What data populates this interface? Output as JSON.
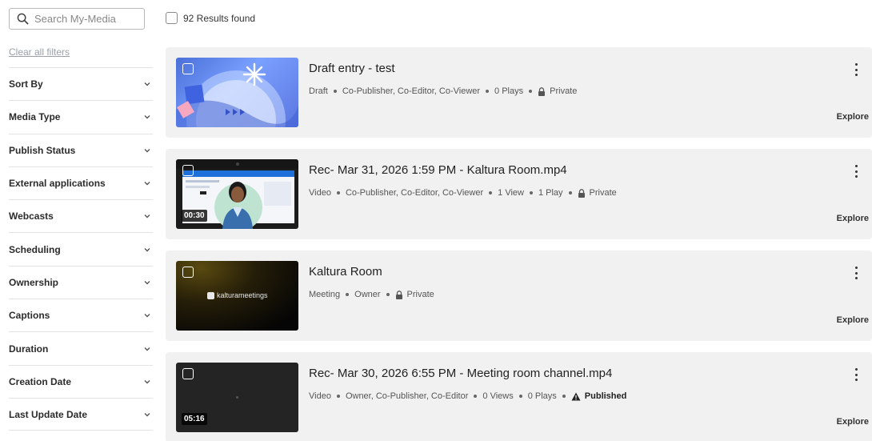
{
  "search": {
    "placeholder": "Search My-Media"
  },
  "sidebar": {
    "clear_filters": "Clear all filters",
    "filters": [
      "Sort By",
      "Media Type",
      "Publish Status",
      "External applications",
      "Webcasts",
      "Scheduling",
      "Ownership",
      "Captions",
      "Duration",
      "Creation Date",
      "Last Update Date"
    ]
  },
  "results": {
    "label": "92 Results found"
  },
  "entries": [
    {
      "title": "Draft entry - test",
      "meta": [
        "Draft",
        "Co-Publisher, Co-Editor, Co-Viewer",
        "0 Plays"
      ],
      "status": "Private",
      "status_icon": "lock-icon",
      "explore": "Explore"
    },
    {
      "title": "Rec- Mar 31, 2026 1:59 PM - Kaltura Room.mp4",
      "meta": [
        "Video",
        "Co-Publisher, Co-Editor, Co-Viewer",
        "1 View",
        "1 Play"
      ],
      "status": "Private",
      "status_icon": "lock-icon",
      "duration": "00:30",
      "explore": "Explore"
    },
    {
      "title": "Kaltura Room",
      "meta": [
        "Meeting",
        "Owner"
      ],
      "status": "Private",
      "status_icon": "lock-icon",
      "thumb_text": "kalturameetings",
      "explore": "Explore"
    },
    {
      "title": "Rec- Mar 30, 2026 6:55 PM - Meeting room channel.mp4",
      "meta": [
        "Video",
        "Owner, Co-Publisher, Co-Editor",
        "0 Views",
        "0 Plays"
      ],
      "status": "Published",
      "status_icon": "warning-icon",
      "duration": "05:16",
      "explore": "Explore"
    }
  ]
}
